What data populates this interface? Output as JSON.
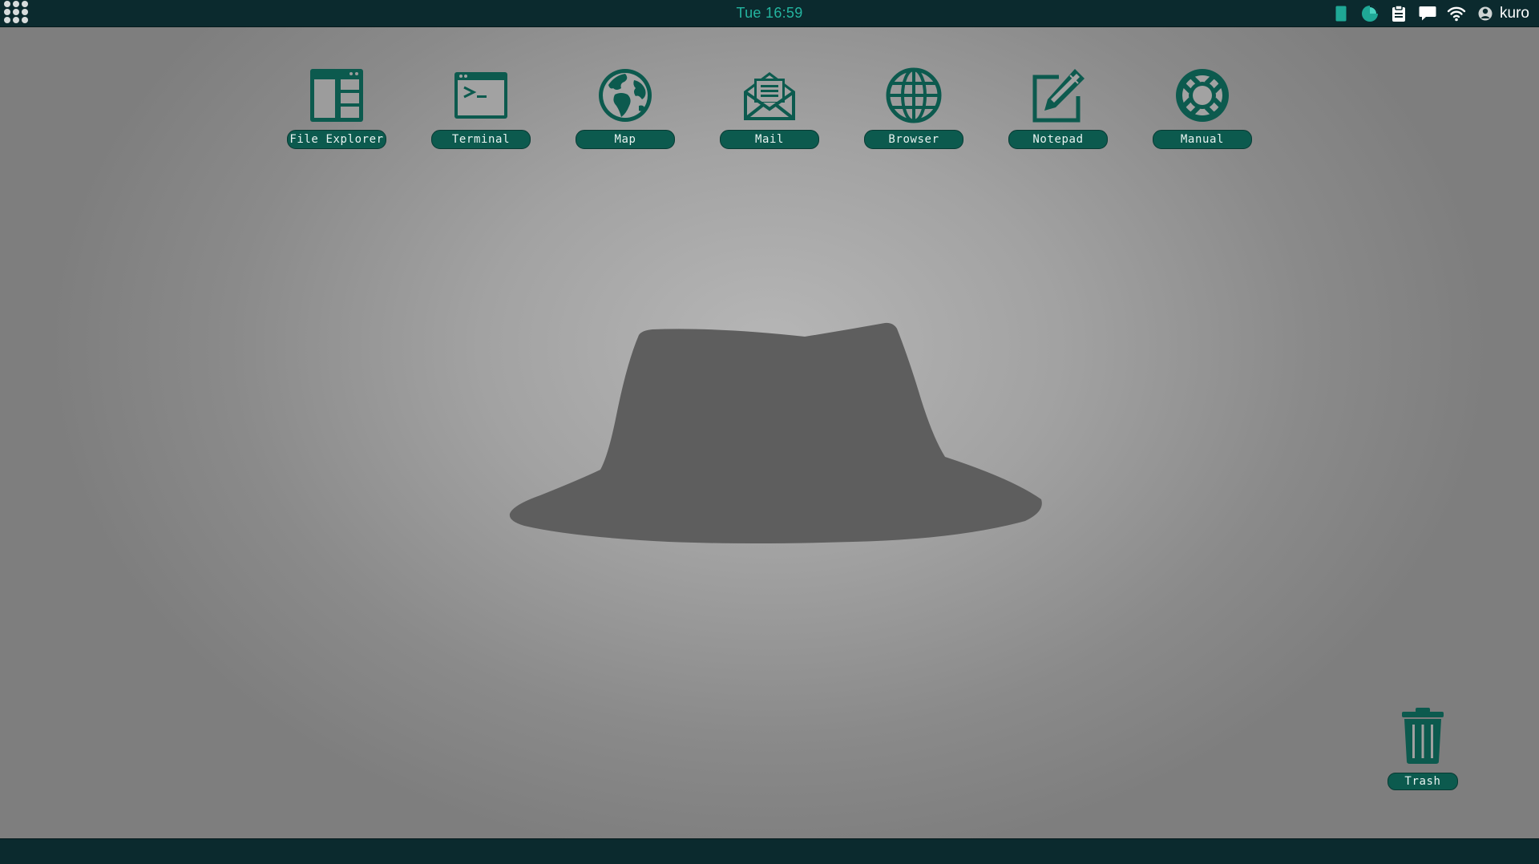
{
  "topbar": {
    "clock": "Tue 16:59",
    "user": "kuro",
    "tray_icons": [
      "battery-icon",
      "pie-status-icon",
      "clipboard-icon",
      "chat-icon",
      "wifi-icon",
      "user-icon"
    ]
  },
  "desktop": {
    "icons": [
      {
        "label": "File Explorer",
        "icon": "file-explorer-icon"
      },
      {
        "label": "Terminal",
        "icon": "terminal-icon"
      },
      {
        "label": "Map",
        "icon": "globe-map-icon"
      },
      {
        "label": "Mail",
        "icon": "mail-icon"
      },
      {
        "label": "Browser",
        "icon": "browser-globe-icon"
      },
      {
        "label": "Notepad",
        "icon": "notepad-icon"
      },
      {
        "label": "Manual",
        "icon": "lifebuoy-icon"
      }
    ],
    "trash": {
      "label": "Trash",
      "icon": "trash-icon"
    },
    "wallpaper": "fedora-hat-logo"
  },
  "colors": {
    "bar": "#0b2a2e",
    "accent": "#0c5a4e",
    "clock": "#24b5a0",
    "icon": "#0c5a4e",
    "hat": "#5e5e5e"
  }
}
